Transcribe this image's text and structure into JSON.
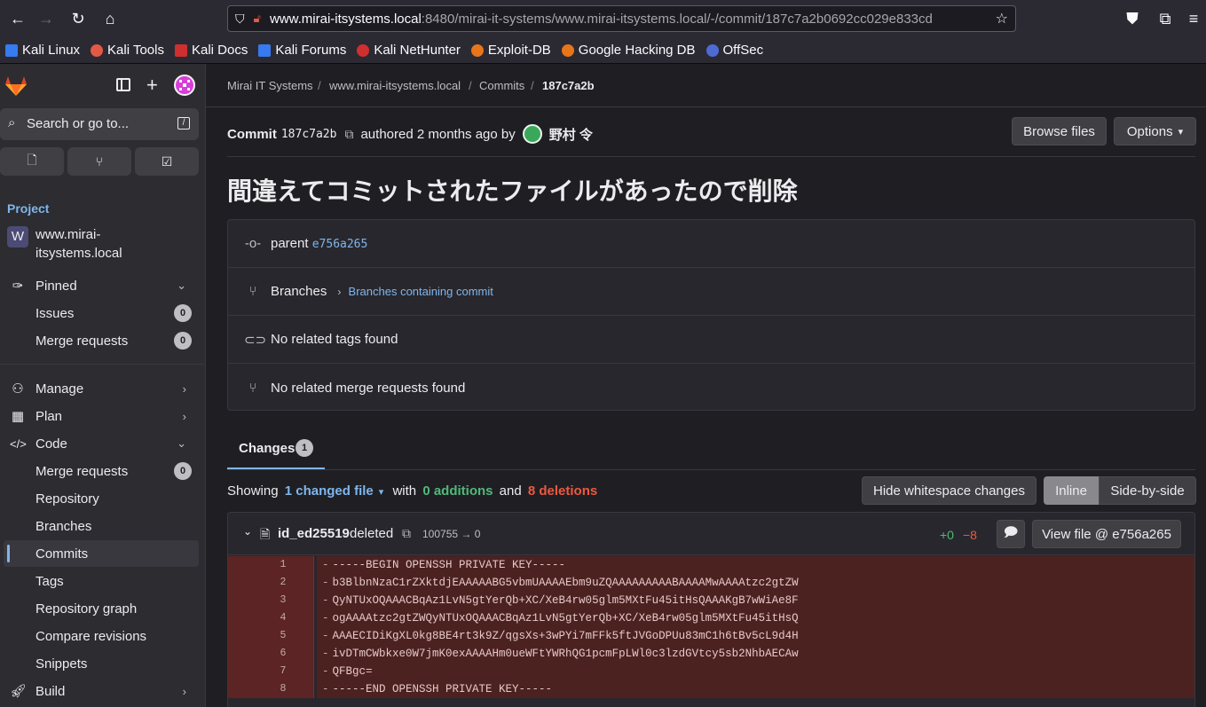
{
  "browser": {
    "url_host": "www.mirai-itsystems.local",
    "url_rest": ":8480/mirai-it-systems/www.mirai-itsystems.local/-/commit/187c7a2b0692cc029e833cd",
    "bookmarks": [
      {
        "label": "Kali Linux",
        "color": "#367bf0"
      },
      {
        "label": "Kali Tools",
        "color": "#e25a45"
      },
      {
        "label": "Kali Docs",
        "color": "#d02f2f"
      },
      {
        "label": "Kali Forums",
        "color": "#367bf0"
      },
      {
        "label": "Kali NetHunter",
        "color": "#d02f2f"
      },
      {
        "label": "Exploit-DB",
        "color": "#e8751a"
      },
      {
        "label": "Google Hacking DB",
        "color": "#e8751a"
      },
      {
        "label": "OffSec",
        "color": "#4d6bd3"
      }
    ]
  },
  "sidebar": {
    "search_placeholder": "Search or go to...",
    "search_shortcut": "/",
    "section_label": "Project",
    "project_initial": "W",
    "project_name_line1": "www.mirai-",
    "project_name_line2": "itsystems.local",
    "pinned": "Pinned",
    "issues": {
      "label": "Issues",
      "count": "0"
    },
    "merge_requests": {
      "label": "Merge requests",
      "count": "0"
    },
    "manage": "Manage",
    "plan": "Plan",
    "code": "Code",
    "code_items": {
      "merge_requests": {
        "label": "Merge requests",
        "count": "0"
      },
      "repository": "Repository",
      "branches": "Branches",
      "commits": "Commits",
      "tags": "Tags",
      "repository_graph": "Repository graph",
      "compare_revisions": "Compare revisions",
      "snippets": "Snippets"
    },
    "build": "Build"
  },
  "breadcrumb": {
    "items": [
      "Mirai IT Systems",
      "www.mirai-itsystems.local",
      "Commits",
      "187c7a2b"
    ]
  },
  "commit": {
    "label": "Commit",
    "sha": "187c7a2b",
    "authored": "authored 2 months ago by",
    "author": "野村 令",
    "title": "間違えてコミットされたファイルがあったので削除",
    "browse_files": "Browse files",
    "options": "Options",
    "parent_label": "parent",
    "parent_sha": "e756a265",
    "branches_label": "Branches",
    "branches_link": "Branches containing commit",
    "no_tags": "No related tags found",
    "no_mrs": "No related merge requests found"
  },
  "changes": {
    "tab_label": "Changes",
    "tab_count": "1",
    "showing": "Showing",
    "changed_files": "1 changed file",
    "with": "with",
    "additions": "0 additions",
    "and": "and",
    "deletions": "8 deletions",
    "hide_whitespace": "Hide whitespace changes",
    "inline": "Inline",
    "side_by_side": "Side-by-side"
  },
  "file": {
    "name": "id_ed25519",
    "status": "deleted",
    "mode": "100755 → 0",
    "plus": "+0",
    "minus": "−8",
    "view_file": "View file @ e756a265"
  },
  "diff_lines": [
    {
      "n": "1",
      "text": "-----BEGIN OPENSSH PRIVATE KEY-----"
    },
    {
      "n": "2",
      "text": "b3BlbnNzaC1rZXktdjEAAAAABG5vbmUAAAAEbm9uZQAAAAAAAAABAAAAMwAAAAtzc2gtZW"
    },
    {
      "n": "3",
      "text": "QyNTUxOQAAACBqAz1LvN5gtYerQb+XC/XeB4rw05glm5MXtFu45itHsQAAAKgB7wWiAe8F"
    },
    {
      "n": "4",
      "text": "ogAAAAtzc2gtZWQyNTUxOQAAACBqAz1LvN5gtYerQb+XC/XeB4rw05glm5MXtFu45itHsQ"
    },
    {
      "n": "5",
      "text": "AAAECIDiKgXL0kg8BE4rt3k9Z/qgsXs+3wPYi7mFFk5ftJVGoDPUu83mC1h6tBv5cL9d4H"
    },
    {
      "n": "6",
      "text": "ivDTmCWbkxe0W7jmK0exAAAAHm0ueWFtYWRhQG1pcmFpLWl0c3lzdGVtcy5sb2NhbAECAw"
    },
    {
      "n": "7",
      "text": "QFBgc="
    },
    {
      "n": "8",
      "text": "-----END OPENSSH PRIVATE KEY-----"
    }
  ]
}
